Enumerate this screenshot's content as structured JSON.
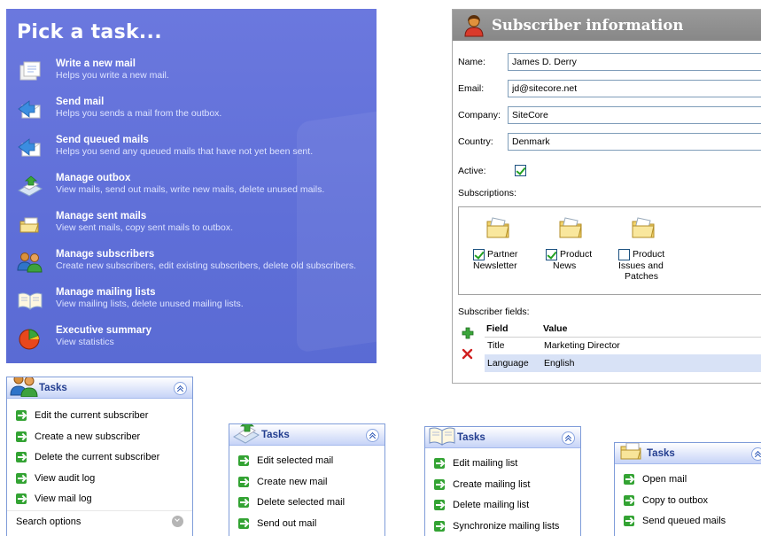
{
  "pick_panel": {
    "title": "Pick a task...",
    "items": [
      {
        "title": "Write a new mail",
        "desc": "Helps you write a new mail.",
        "icon": "new-mail-icon"
      },
      {
        "title": "Send mail",
        "desc": "Helps you sends a mail from the outbox.",
        "icon": "send-mail-icon"
      },
      {
        "title": "Send queued mails",
        "desc": "Helps you send any queued mails that have not yet been sent.",
        "icon": "send-queued-icon"
      },
      {
        "title": "Manage outbox",
        "desc": "View mails, send out mails, write new mails, delete unused mails.",
        "icon": "outbox-icon"
      },
      {
        "title": "Manage sent mails",
        "desc": "View sent mails, copy sent mails to outbox.",
        "icon": "sent-mails-icon"
      },
      {
        "title": "Manage subscribers",
        "desc": "Create new subscribers, edit existing subscribers, delete old subscribers.",
        "icon": "subscribers-icon"
      },
      {
        "title": "Manage mailing lists",
        "desc": "View mailing lists, delete unused mailing lists.",
        "icon": "mailing-lists-icon"
      },
      {
        "title": "Executive summary",
        "desc": "View statistics",
        "icon": "summary-icon"
      }
    ]
  },
  "subscriber": {
    "title": "Subscriber information",
    "name_label": "Name:",
    "name_value": "James D. Derry",
    "email_label": "Email:",
    "email_value": "jd@sitecore.net",
    "company_label": "Company:",
    "company_value": "SiteCore",
    "country_label": "Country:",
    "country_value": "Denmark",
    "active_label": "Active:",
    "active": true,
    "subscriptions_label": "Subscriptions:",
    "subscriptions": [
      {
        "line1": "Partner",
        "line2": "Newsletter",
        "line3": "",
        "checked": true
      },
      {
        "line1": "Product",
        "line2": "News",
        "line3": "",
        "checked": true
      },
      {
        "line1": "Product",
        "line2": "Issues and",
        "line3": "Patches",
        "checked": false
      }
    ],
    "fields_label": "Subscriber fields:",
    "fields_header": {
      "field": "Field",
      "value": "Value"
    },
    "fields_rows": [
      {
        "field": "Title",
        "value": "Marketing Director"
      },
      {
        "field": "Language",
        "value": "English"
      }
    ]
  },
  "task_boxes": [
    {
      "title": "Tasks",
      "icon": "subscribers-icon",
      "items": [
        "Edit the current subscriber",
        "Create a new subscriber",
        "Delete the current subscriber",
        "View audit log",
        "View mail log"
      ],
      "search_options": "Search options"
    },
    {
      "title": "Tasks",
      "icon": "outbox-icon",
      "items": [
        "Edit selected mail",
        "Create new mail",
        "Delete selected mail",
        "Send out mail"
      ]
    },
    {
      "title": "Tasks",
      "icon": "mailing-lists-icon",
      "items": [
        "Edit mailing list",
        "Create mailing list",
        "Delete mailing list",
        "Synchronize mailing lists"
      ]
    },
    {
      "title": "Tasks",
      "icon": "sent-mails-icon",
      "items": [
        "Open mail",
        "Copy to outbox",
        "Send queued mails"
      ]
    }
  ]
}
